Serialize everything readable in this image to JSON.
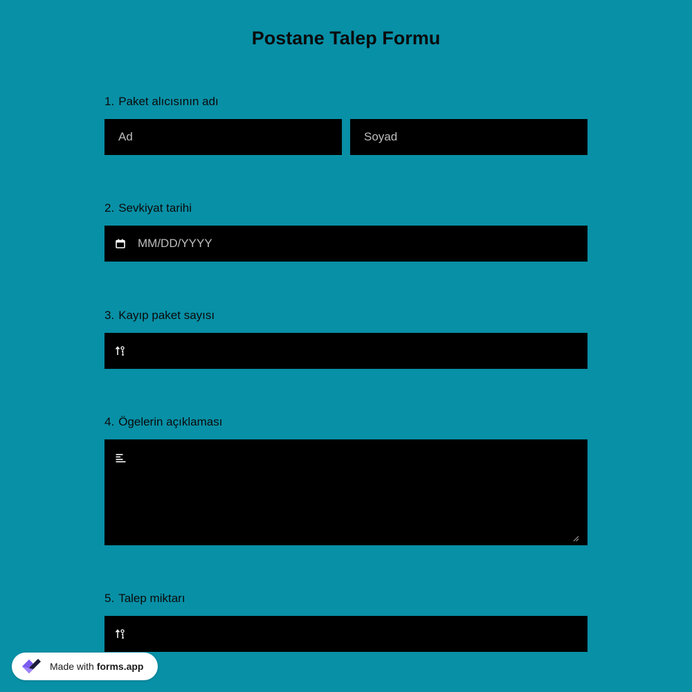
{
  "form": {
    "title": "Postane Talep Formu",
    "questions": [
      {
        "number": "1.",
        "label": "Paket alıcısının adı",
        "first_placeholder": "Ad",
        "last_placeholder": "Soyad"
      },
      {
        "number": "2.",
        "label": "Sevkiyat tarihi",
        "placeholder": "MM/DD/YYYY",
        "icon": "calendar-icon"
      },
      {
        "number": "3.",
        "label": "Kayıp paket sayısı",
        "icon": "number-sort-icon"
      },
      {
        "number": "4.",
        "label": "Ögelerin açıklaması",
        "icon": "text-lines-icon"
      },
      {
        "number": "5.",
        "label": "Talep miktarı",
        "icon": "number-sort-icon"
      }
    ]
  },
  "badge": {
    "made_with": "Made with",
    "brand": "forms.app",
    "logo_icon": "forms-app-logo-icon"
  },
  "colors": {
    "background": "#0890a6",
    "field": "#000000",
    "logo_purple": "#7b5cf0",
    "logo_dark": "#1c1c3a"
  }
}
